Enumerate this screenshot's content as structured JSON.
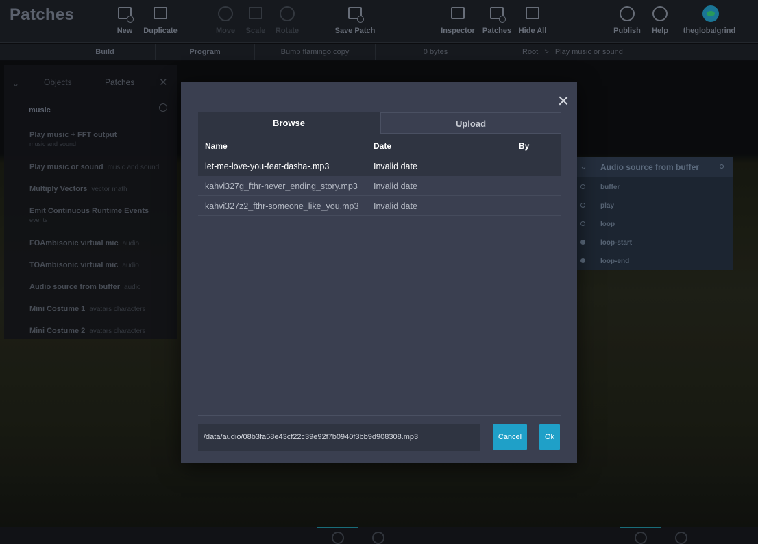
{
  "app": {
    "title": "Patches",
    "toolbar": {
      "new": "New",
      "duplicate": "Duplicate",
      "move": "Move",
      "scale": "Scale",
      "rotate": "Rotate",
      "save_patch": "Save Patch",
      "inspector": "Inspector",
      "patches": "Patches",
      "hide_all": "Hide All",
      "publish": "Publish",
      "help": "Help",
      "user": "theglobalgrind"
    },
    "subbar": {
      "build": "Build",
      "program": "Program",
      "project": "Bump flamingo copy",
      "size": "0 bytes",
      "breadcrumb_root": "Root",
      "breadcrumb_sep": ">",
      "breadcrumb_current": "Play music or sound"
    }
  },
  "sidebar": {
    "tab_objects": "Objects",
    "tab_patches": "Patches",
    "search_value": "music",
    "items": [
      {
        "name": "Play music + FFT output",
        "tag": "",
        "sub": "music and sound"
      },
      {
        "name": "Play music or sound",
        "tag": "music and sound",
        "sub": ""
      },
      {
        "name": "Multiply Vectors",
        "tag": "vector math",
        "sub": ""
      },
      {
        "name": "Emit Continuous Runtime Events",
        "tag": "",
        "sub": "events"
      },
      {
        "name": "FOAmbisonic virtual mic",
        "tag": "audio",
        "sub": ""
      },
      {
        "name": "TOAmbisonic virtual mic",
        "tag": "audio",
        "sub": ""
      },
      {
        "name": "Audio source from buffer",
        "tag": "audio",
        "sub": ""
      },
      {
        "name": "Mini Costume 1",
        "tag": "avatars characters",
        "sub": ""
      },
      {
        "name": "Mini Costume 2",
        "tag": "avatars characters",
        "sub": ""
      }
    ]
  },
  "node": {
    "title": "Audio source from buffer",
    "ports": [
      "buffer",
      "play",
      "loop",
      "loop-start",
      "loop-end"
    ]
  },
  "dialog": {
    "tabs": {
      "browse": "Browse",
      "upload": "Upload"
    },
    "columns": {
      "name": "Name",
      "date": "Date",
      "by": "By"
    },
    "files": [
      {
        "name": "let-me-love-you-feat-dasha-.mp3",
        "date": "Invalid date",
        "by": "",
        "selected": true
      },
      {
        "name": "kahvi327g_fthr-never_ending_story.mp3",
        "date": "Invalid date",
        "by": "",
        "selected": false
      },
      {
        "name": "kahvi327z2_fthr-someone_like_you.mp3",
        "date": "Invalid date",
        "by": "",
        "selected": false
      }
    ],
    "path_value": "/data/audio/08b3fa58e43cf22c39e92f7b0940f3bb9d908308.mp3",
    "cancel_label": "Cancel",
    "ok_label": "Ok"
  },
  "colors": {
    "accent": "#1fa0c8",
    "dialog_bg": "#3a3f50",
    "selected_row": "#2f3441"
  }
}
